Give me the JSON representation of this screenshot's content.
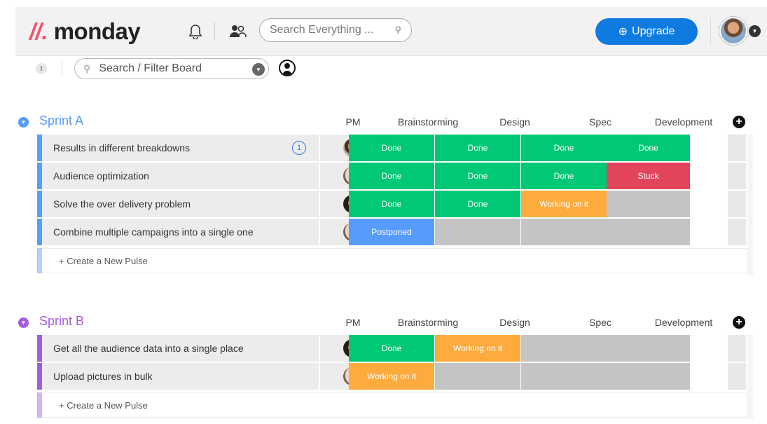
{
  "topbar": {
    "logo_mark": "//.",
    "logo_text": "monday",
    "search_placeholder": "Search Everything ...",
    "upgrade_label": "Upgrade",
    "upgrade_icon": "⊕"
  },
  "filterbar": {
    "info_label": "I",
    "search_placeholder": "Search / Filter Board"
  },
  "columns": [
    "PM",
    "Brainstorming",
    "Design",
    "Spec",
    "Development"
  ],
  "colors": {
    "done": "#00c875",
    "stuck": "#e2445c",
    "working": "#fdab3d",
    "postponed": "#579bfc",
    "empty": "#c4c4c4",
    "sprint_a": "#579bfc",
    "sprint_b": "#a25ddc"
  },
  "groups": [
    {
      "title": "Sprint A",
      "new_pulse": "+ Create a New Pulse",
      "rows": [
        {
          "name": "Results in different breakdowns",
          "count": "1",
          "pm": "a",
          "statuses": [
            "Done",
            "Done",
            "Done",
            "Done"
          ]
        },
        {
          "name": "Audience optimization",
          "count": "",
          "pm": "b",
          "statuses": [
            "Done",
            "Done",
            "Done",
            "Stuck"
          ]
        },
        {
          "name": "Solve the over delivery problem",
          "count": "",
          "pm": "c",
          "statuses": [
            "Done",
            "Done",
            "Working on it",
            ""
          ]
        },
        {
          "name": "Combine multiple campaigns into a single one",
          "count": "",
          "pm": "b",
          "statuses": [
            "Postponed",
            "",
            "",
            ""
          ]
        }
      ]
    },
    {
      "title": "Sprint B",
      "new_pulse": "+ Create a New Pulse",
      "rows": [
        {
          "name": "Get all the audience data into a single place",
          "count": "",
          "pm": "c",
          "statuses": [
            "Done",
            "Working on it",
            "",
            ""
          ]
        },
        {
          "name": "Upload pictures in bulk",
          "count": "",
          "pm": "b",
          "statuses": [
            "Working on it",
            "",
            "",
            ""
          ]
        }
      ]
    }
  ]
}
